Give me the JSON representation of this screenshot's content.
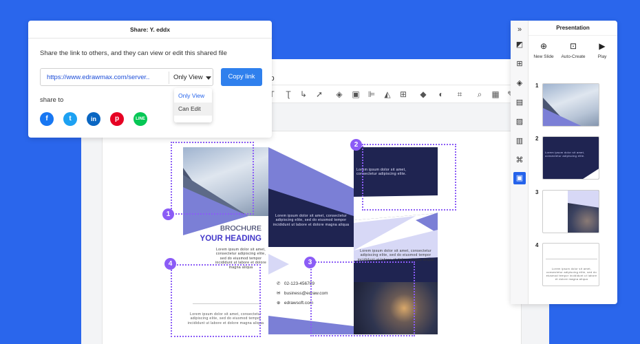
{
  "colors": {
    "background": "#2a66ec",
    "accent_purple": "#8b5cf6",
    "brochure_navy": "#1f2451",
    "brochure_periwinkle": "#7b7fd6",
    "brochure_lavender": "#d7d8f6",
    "link_blue": "#1d4ed8",
    "copy_button": "#2f80ed"
  },
  "editor": {
    "menu_help": "lp"
  },
  "share_dialog": {
    "title": "Share: Y. eddx",
    "description": "Share the link to others, and they can view or edit this shared file",
    "link_url": "https://www.edrawmax.com/server..",
    "permission": "Only View",
    "copy_button": "Copy link",
    "share_to": "share to",
    "dropdown_options": [
      "Only View",
      "Can Edit"
    ],
    "social_icons": [
      "facebook-icon",
      "twitter-icon",
      "linkedin-icon",
      "pinterest-icon",
      "line-icon"
    ]
  },
  "brochure": {
    "heading_small": "BROCHURE",
    "heading_large": "YOUR HEADING",
    "lorem_a": "Lorem ipsum dolor sit amet, consectetur adipiscing elite, sed do eiusmod tempor incididunt ut labore et dolore magna aliqua",
    "lorem_b": "Lorem ipsum dolor sit amet, consectetur adipiscing elite, sed do eiusmod tempor incididunt ut labore et dolore magna aliqua",
    "lorem_c": "Lorem ipsum dolor sit amet, consectetur adipiscing elite.",
    "lorem_d": "Lorem ipsum dolor sit amet, consectetur adipiscing elite, sed do eiusmod tempor incididunt ut labore et dolore magna aliqua",
    "lorem_e": "Lorem ipsum dolor sit amet, consectetur adipiscing elite, sed do eiusmod tempor incididunt ut labore et dolore magna aliqua",
    "lorem_f": "Lorem ipsum dolor sit amet, consectetur adipiscing elite, sed do eiusmod tempor incididunt ut labore et dolore magna aliqua",
    "phone": "02-123-456789",
    "email": "business@edraw.com",
    "website": "edrawsoft.com",
    "callouts": [
      "1",
      "2",
      "3",
      "4"
    ]
  },
  "presentation": {
    "title": "Presentation",
    "tools": [
      "New Slide",
      "Auto-Create",
      "Play"
    ],
    "slides": [
      "1",
      "2",
      "3",
      "4"
    ],
    "slide2_text": "Lorem ipsum dolor sit amet, consectetur adipiscing elite.",
    "slide4_text": "Lorem ipsum dolor sit amet, consectetur adipiscing elite, sed do eiusmod tempor incididunt ut labore et dolore magna aliqua"
  }
}
